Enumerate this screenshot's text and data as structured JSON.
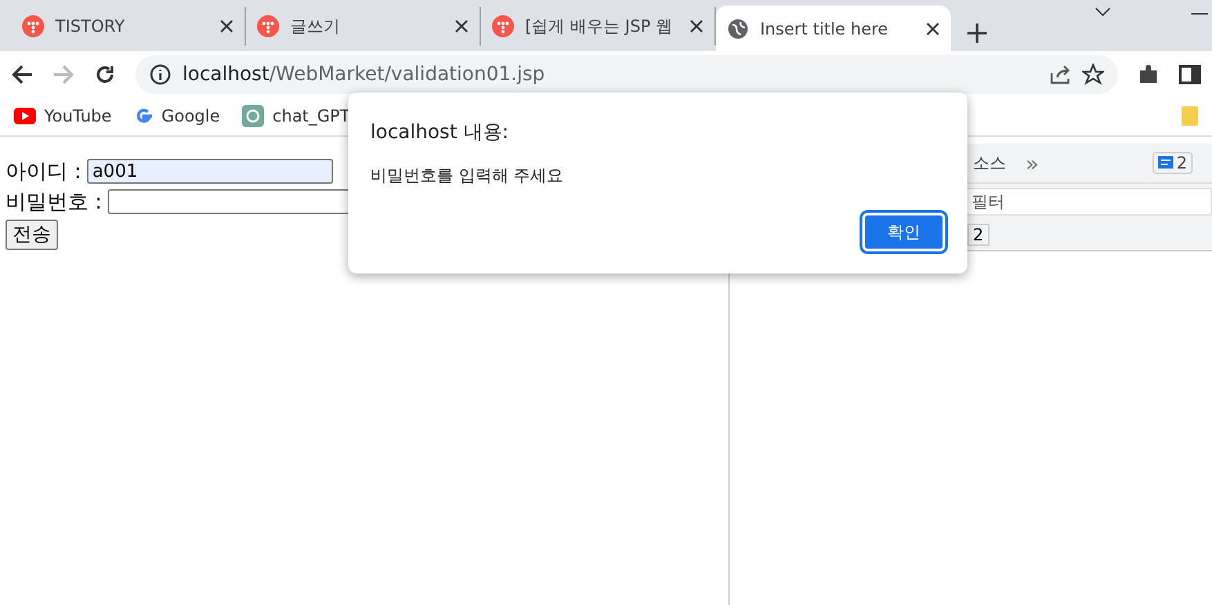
{
  "tabs": [
    {
      "title": "TISTORY",
      "kind": "tistory",
      "selected": false
    },
    {
      "title": "글쓰기",
      "kind": "tistory",
      "selected": false
    },
    {
      "title": "[쉽게 배우는 JSP 웹",
      "kind": "tistory",
      "selected": false
    },
    {
      "title": "Insert title here",
      "kind": "globe",
      "selected": true
    }
  ],
  "address": {
    "host": "localhost",
    "path": "/WebMarket/validation01.jsp"
  },
  "bookmarks": [
    {
      "label": "YouTube",
      "kind": "youtube"
    },
    {
      "label": "Google",
      "kind": "google"
    },
    {
      "label": "chat_GPT",
      "kind": "gpt"
    }
  ],
  "form": {
    "fields": [
      {
        "label": "아이디 :",
        "value": "a001",
        "autofilled": true
      },
      {
        "label": "비밀번호 :",
        "autofilled": false
      }
    ],
    "submit": "전송"
  },
  "devtools": {
    "tabs": [
      "소스"
    ],
    "overflow": "»",
    "issues_count": "2",
    "filter_placeholder": "필터",
    "row3_text": "2"
  },
  "dialog": {
    "title": "localhost 내용:",
    "message": "비밀번호를 입력해 주세요",
    "ok": "확인"
  }
}
